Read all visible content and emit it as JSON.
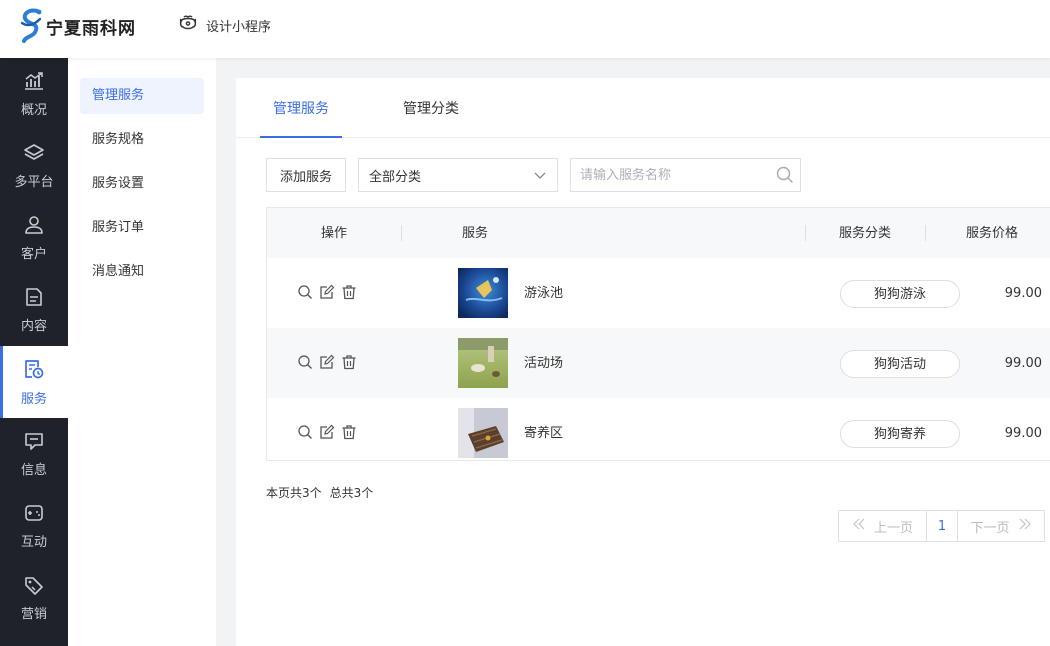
{
  "brand": {
    "name": "宁夏雨科网"
  },
  "header": {
    "design_link": "设计小程序"
  },
  "nav": [
    {
      "label": "概况",
      "icon": "chart-trend-icon"
    },
    {
      "label": "多平台",
      "icon": "layers-icon"
    },
    {
      "label": "客户",
      "icon": "user-icon"
    },
    {
      "label": "内容",
      "icon": "document-icon"
    },
    {
      "label": "服务",
      "icon": "service-doc-icon",
      "active": true
    },
    {
      "label": "信息",
      "icon": "message-icon"
    },
    {
      "label": "互动",
      "icon": "gamepad-icon"
    },
    {
      "label": "营销",
      "icon": "tag-icon"
    }
  ],
  "sub_menu": [
    {
      "label": "管理服务",
      "active": true
    },
    {
      "label": "服务规格"
    },
    {
      "label": "服务设置"
    },
    {
      "label": "服务订单"
    },
    {
      "label": "消息通知"
    }
  ],
  "tabs": [
    {
      "label": "管理服务",
      "active": true
    },
    {
      "label": "管理分类"
    }
  ],
  "toolbar": {
    "add_label": "添加服务",
    "category_selected": "全部分类",
    "search_placeholder": "请输入服务名称"
  },
  "table": {
    "columns": [
      "操作",
      "服务",
      "服务分类",
      "服务价格"
    ],
    "rows": [
      {
        "name": "游泳池",
        "category": "狗狗游泳",
        "price": "99.00",
        "thumb": "pool"
      },
      {
        "name": "活动场",
        "category": "狗狗活动",
        "price": "99.00",
        "thumb": "field"
      },
      {
        "name": "寄养区",
        "category": "狗狗寄养",
        "price": "99.00",
        "thumb": "kennel"
      }
    ]
  },
  "summary": {
    "page_count": "本页共3个",
    "total_count": "总共3个"
  },
  "pager": {
    "prev": "上一页",
    "current": "1",
    "next": "下一页"
  },
  "colors": {
    "accent": "#3b6fe0",
    "sidebar_bg": "#1f2329"
  }
}
